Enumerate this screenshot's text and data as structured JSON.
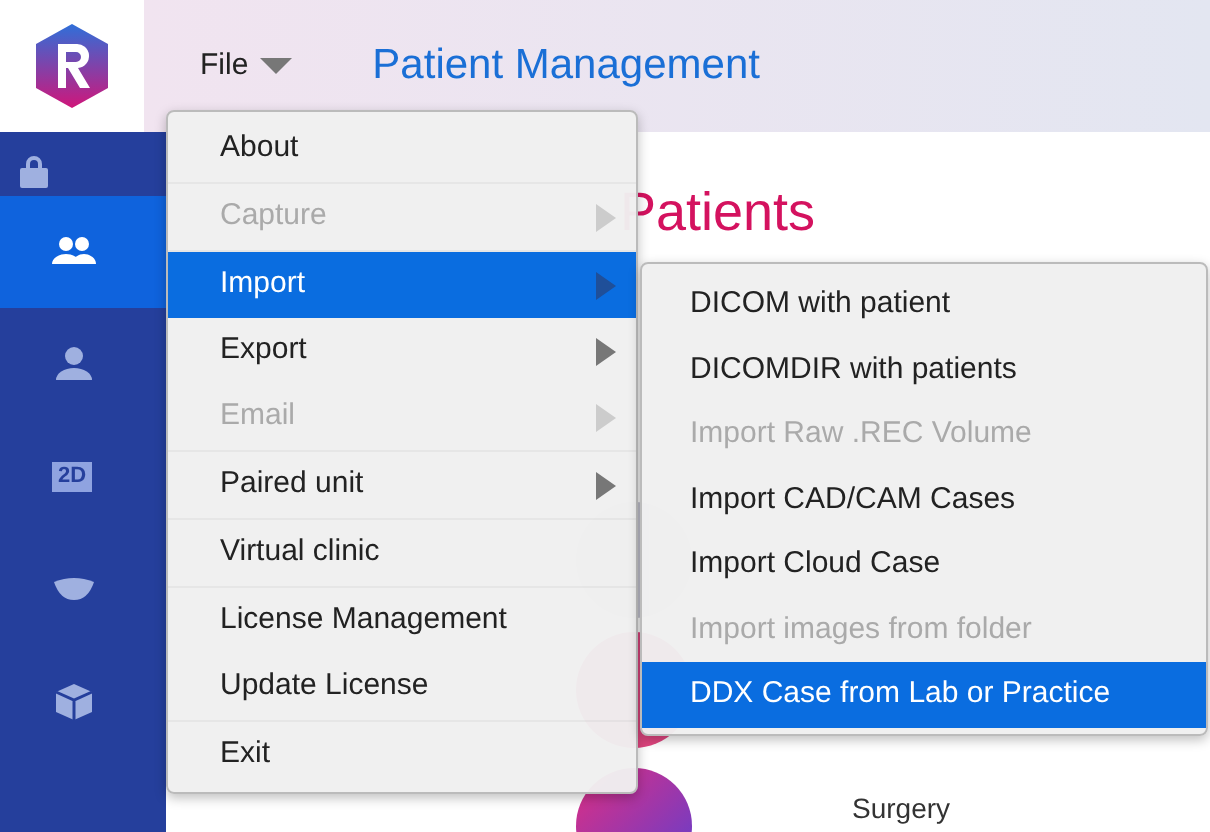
{
  "header": {
    "menu_label": "File",
    "title": "Patient Management"
  },
  "sidebar": {
    "items": [
      {
        "selected": true
      },
      {
        "selected": false
      },
      {
        "icon_text": "2D",
        "selected": false
      },
      {
        "selected": false
      },
      {
        "selected": false
      }
    ]
  },
  "content": {
    "heading": "Patients",
    "footer_text": "Surgery"
  },
  "file_menu": {
    "items": [
      {
        "kind": "item",
        "label": "About",
        "disabled": false,
        "selected": false,
        "has_submenu": false
      },
      {
        "kind": "separator"
      },
      {
        "kind": "item",
        "label": "Capture",
        "disabled": true,
        "selected": false,
        "has_submenu": true
      },
      {
        "kind": "separator"
      },
      {
        "kind": "item",
        "label": "Import",
        "disabled": false,
        "selected": true,
        "has_submenu": true
      },
      {
        "kind": "item",
        "label": "Export",
        "disabled": false,
        "selected": false,
        "has_submenu": true
      },
      {
        "kind": "item",
        "label": "Email",
        "disabled": true,
        "selected": false,
        "has_submenu": true
      },
      {
        "kind": "separator"
      },
      {
        "kind": "item",
        "label": "Paired unit",
        "disabled": false,
        "selected": false,
        "has_submenu": true
      },
      {
        "kind": "separator"
      },
      {
        "kind": "item",
        "label": "Virtual clinic",
        "disabled": false,
        "selected": false,
        "has_submenu": false
      },
      {
        "kind": "separator"
      },
      {
        "kind": "item",
        "label": "License Management",
        "disabled": false,
        "selected": false,
        "has_submenu": false
      },
      {
        "kind": "item",
        "label": "Update License",
        "disabled": false,
        "selected": false,
        "has_submenu": false
      },
      {
        "kind": "separator"
      },
      {
        "kind": "item",
        "label": "Exit",
        "disabled": false,
        "selected": false,
        "has_submenu": false
      }
    ]
  },
  "import_submenu": {
    "items": [
      {
        "label": "DICOM with patient",
        "disabled": false,
        "selected": false
      },
      {
        "label": "DICOMDIR with patients",
        "disabled": false,
        "selected": false
      },
      {
        "label": "Import Raw .REC Volume",
        "disabled": true,
        "selected": false
      },
      {
        "label": "Import CAD/CAM Cases",
        "disabled": false,
        "selected": false
      },
      {
        "label": "Import Cloud Case",
        "disabled": false,
        "selected": false
      },
      {
        "label": "Import images from folder",
        "disabled": true,
        "selected": false
      },
      {
        "label": "DDX Case from Lab or Practice",
        "disabled": false,
        "selected": true
      }
    ]
  }
}
